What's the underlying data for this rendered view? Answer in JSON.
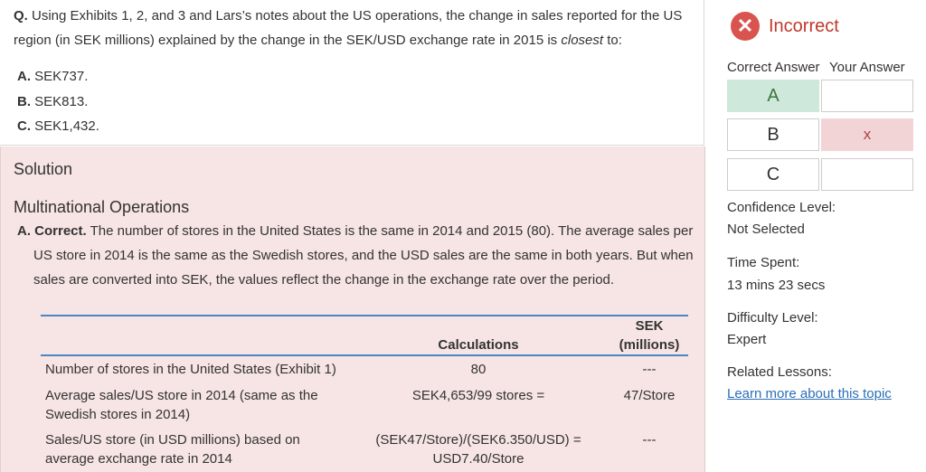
{
  "question": {
    "prefix": "Q.",
    "line1": " Using Exhibits 1, 2, and 3 and Lars’s notes about the US operations, the change in sales reported for the US",
    "line2a": "region (in SEK millions) explained by the change in the SEK/USD exchange rate in 2015 is ",
    "line2_emph": "closest",
    "line2b": " to:",
    "choices": [
      {
        "letter": "A.",
        "text": " SEK737."
      },
      {
        "letter": "B.",
        "text": " SEK813."
      },
      {
        "letter": "C.",
        "text": " SEK1,432."
      }
    ]
  },
  "solution": {
    "title": "Solution",
    "section_title": "Multinational Operations",
    "correct_label": "A. Correct.",
    "line1": " The number of stores in the United States is the same in 2014 and 2015 (80). The average sales per",
    "line2": "US store in 2014 is the same as the Swedish stores, and the USD sales are the same in both years. But when",
    "line3": "sales are converted into SEK, the values reflect the change in the exchange rate over the period.",
    "table": {
      "col_calc": "Calculations",
      "col_sek_1": "SEK",
      "col_sek_2": "(millions)",
      "rows": [
        {
          "label1": "Number of stores in the United States (Exhibit 1)",
          "label2": "",
          "calc1": "80",
          "calc2": "",
          "sek": "---"
        },
        {
          "label1": "Average sales/US store in 2014 (same as the",
          "label2": "Swedish stores in 2014)",
          "calc1": "SEK4,653/99 stores =",
          "calc2": "",
          "sek": "47/Store"
        },
        {
          "label1": "Sales/US store (in USD millions) based on",
          "label2": "average exchange rate in 2014",
          "calc1": "(SEK47/Store)/(SEK6.350/USD) =",
          "calc2": "USD7.40/Store",
          "sek": "---"
        }
      ]
    }
  },
  "result": {
    "icon": "x-circle-icon",
    "status": "Incorrect",
    "correct_header": "Correct Answer",
    "your_header": "Your Answer",
    "options": [
      {
        "letter": "A",
        "correct": true,
        "your_mark": ""
      },
      {
        "letter": "B",
        "correct": false,
        "your_mark": "x"
      },
      {
        "letter": "C",
        "correct": false,
        "your_mark": ""
      }
    ],
    "confidence_label": "Confidence Level:",
    "confidence_value": "Not Selected",
    "time_label": "Time Spent:",
    "time_value": "13 mins 23 secs",
    "difficulty_label": "Difficulty Level:",
    "difficulty_value": "Expert",
    "related_label": "Related Lessons:",
    "related_link": "Learn more about this topic",
    "colors": {
      "correct_bg": "#cfe8dc",
      "wrong_bg": "#f2d4d6",
      "incorrect_red": "#d9534f",
      "link": "#2a6fb7"
    }
  }
}
